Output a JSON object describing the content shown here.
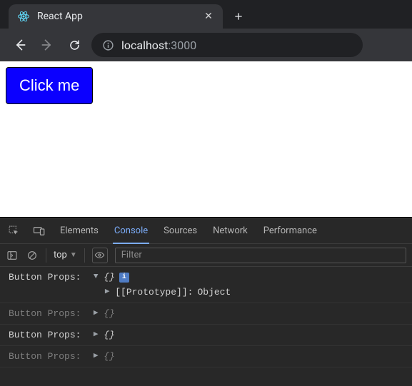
{
  "browser": {
    "tab_title": "React App",
    "new_tab_glyph": "+",
    "close_glyph": "✕"
  },
  "toolbar": {
    "url_host": "localhost",
    "url_port": ":3000"
  },
  "page": {
    "button_label": "Click me"
  },
  "devtools": {
    "tabs": {
      "elements": "Elements",
      "console": "Console",
      "sources": "Sources",
      "network": "Network",
      "performance": "Performance"
    },
    "subbar": {
      "context": "top",
      "filter_placeholder": "Filter"
    },
    "logs": [
      {
        "label": "Button Props: ",
        "expanded": true,
        "dim": false,
        "info_badge": "i",
        "children": {
          "proto_key": "[[Prototype]]",
          "proto_val": "Object"
        }
      },
      {
        "label": "Button Props: ",
        "expanded": false,
        "dim": true
      },
      {
        "label": "Button Props: ",
        "expanded": false,
        "dim": false
      },
      {
        "label": "Button Props: ",
        "expanded": false,
        "dim": true
      }
    ],
    "braces": "{}"
  }
}
